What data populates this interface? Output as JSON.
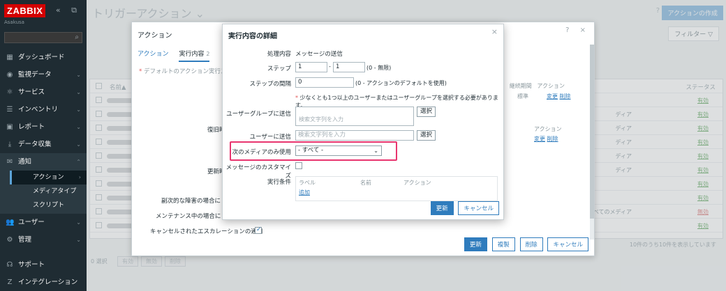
{
  "sidebar": {
    "logo": "ZABBIX",
    "collapse_icons": "« ⧉",
    "subtitle": "Asakusa",
    "nav": [
      {
        "label": "ダッシュボード",
        "icon": "dashboard-icon",
        "glyph": "▦"
      },
      {
        "label": "監視データ",
        "icon": "eye-icon",
        "glyph": "◉"
      },
      {
        "label": "サービス",
        "icon": "services-icon",
        "glyph": "⚛"
      },
      {
        "label": "インベントリ",
        "icon": "inventory-icon",
        "glyph": "☰"
      },
      {
        "label": "レポート",
        "icon": "report-icon",
        "glyph": "▣"
      },
      {
        "label": "データ収集",
        "icon": "download-icon",
        "glyph": "⤓"
      },
      {
        "label": "通知",
        "icon": "mail-icon",
        "glyph": "✉"
      }
    ],
    "subnav": [
      {
        "label": "アクション"
      },
      {
        "label": "メディアタイプ"
      },
      {
        "label": "スクリプト"
      }
    ],
    "nav2": [
      {
        "label": "ユーザー",
        "icon": "users-icon",
        "glyph": "👥"
      },
      {
        "label": "管理",
        "icon": "gear-icon",
        "glyph": "⚙"
      }
    ],
    "bottom": [
      {
        "label": "サポート",
        "icon": "headset-icon",
        "glyph": "☊"
      },
      {
        "label": "インテグレーション",
        "icon": "integration-icon",
        "glyph": "Z"
      }
    ]
  },
  "page": {
    "title": "トリガーアクション",
    "help": "?",
    "create_button": "アクションの作成",
    "filter_tab": "フィルター",
    "table": {
      "col_name": "名前▲",
      "col_status": "ステータス",
      "rows": [
        {
          "media": "",
          "status": "有効"
        },
        {
          "media": "ディア",
          "status": "有効"
        },
        {
          "media": "ディア",
          "status": "有効"
        },
        {
          "media": "ディア",
          "status": "有効"
        },
        {
          "media": "ディア",
          "status": "有効"
        },
        {
          "media": "ディア",
          "status": "有効"
        },
        {
          "media": "",
          "status": "有効"
        },
        {
          "media": "",
          "status": "有効"
        },
        {
          "media": "すべてのメディア",
          "status": "無効"
        },
        {
          "media": "",
          "status": "有効"
        }
      ]
    },
    "count_text": "10件のうち10件を表示しています",
    "footer": {
      "selected": "0 選択",
      "b1": "有効",
      "b2": "無効",
      "b3": "削除"
    }
  },
  "action_dialog": {
    "title": "アクション",
    "tabs": [
      {
        "label": "アクション"
      },
      {
        "label": "実行内容",
        "count": "2"
      }
    ],
    "required_note": "デフォルトのアクション実行ステ",
    "grid_header": {
      "c1": "期",
      "c2": "継続期間",
      "c3": "アクション"
    },
    "grid_row": {
      "duration": "標準",
      "edit": "変更",
      "delete": "削除"
    },
    "recovery_label": "復旧時",
    "recovery_action_header": "アクション",
    "recovery_edit": "変更",
    "recovery_delete": "削除",
    "update_label": "更新時",
    "pause_symptoms": "副次的な障害の場合に",
    "pause_maintenance": "メンテナンス中の場合に",
    "cancelled_label": "キャンセルされたエスカレーションの通知",
    "buttons": {
      "update": "更新",
      "clone": "複製",
      "delete": "削除",
      "cancel": "キャンセル"
    }
  },
  "detail_dialog": {
    "title": "実行内容の詳細",
    "operation_label": "処理内容",
    "operation_value": "メッセージの送信",
    "steps_label": "ステップ",
    "step_from": "1",
    "step_to": "1",
    "steps_hint": "(0 - 無限)",
    "duration_label": "ステップの間隔",
    "duration_value": "0",
    "duration_hint": "(0 - アクションのデフォルトを使用)",
    "warning": "少なくとも1つ以上のユーザーまたはユーザーグループを選択する必要があります。",
    "usergroup_label": "ユーザーグループに送信",
    "usergroup_placeholder": "検索文字列を入力",
    "user_label": "ユーザーに送信",
    "user_placeholder": "検索文字列を入力",
    "select_button": "選択",
    "media_label": "次のメディアのみ使用",
    "media_value": "- すべて -",
    "custom_message_label": "メッセージのカスタマイズ",
    "conditions_label": "実行条件",
    "cond_col_label": "ラベル",
    "cond_col_name": "名前",
    "cond_col_action": "アクション",
    "cond_add": "追加",
    "buttons": {
      "update": "更新",
      "cancel": "キャンセル"
    },
    "highlight_color": "#e8356f"
  }
}
